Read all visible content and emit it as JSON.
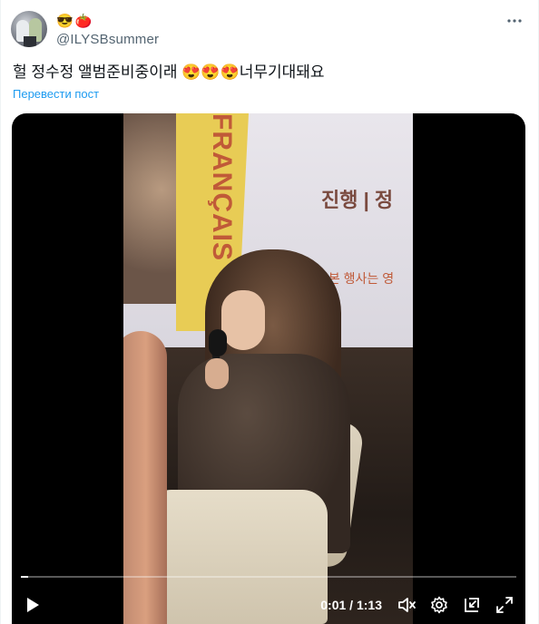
{
  "author": {
    "emojis": [
      "😎",
      "🍅"
    ],
    "handle": "@ILYSBsummer"
  },
  "tweet": {
    "text_part1": "헐 정수정 앨범준비중이래 ",
    "emojis": [
      "😍",
      "😍",
      "😍"
    ],
    "text_part2": "너무기대돼요",
    "translate_label": "Перевести пост"
  },
  "video": {
    "slide_text_top": "진행 | 정",
    "slide_text_bottom": "※ 본 행사는 영",
    "poster_text": "FRANÇAIS",
    "current_time": "0:01",
    "duration": "1:13",
    "time_separator": " / ",
    "progress": 0.014
  },
  "icons": {
    "more": "more-icon",
    "play": "play-icon",
    "mute": "volume-muted-icon",
    "settings": "gear-icon",
    "pip": "picture-in-picture-icon",
    "fullscreen": "fullscreen-icon"
  },
  "colors": {
    "link": "#1d9bf0",
    "secondary_text": "#536471",
    "video_bg": "#000000"
  }
}
